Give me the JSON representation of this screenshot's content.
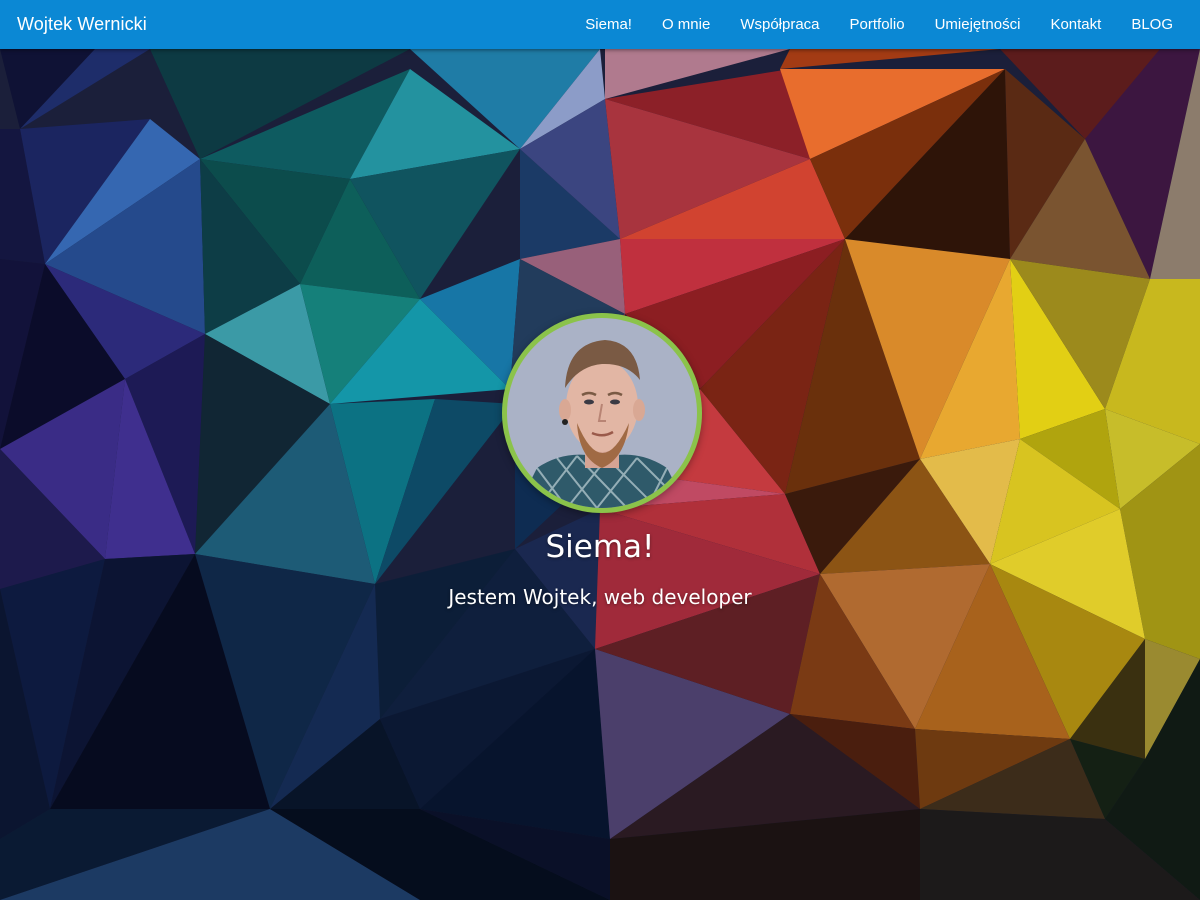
{
  "navbar": {
    "brand": "Wojtek Wernicki",
    "items": [
      {
        "label": "Siema!"
      },
      {
        "label": "O mnie"
      },
      {
        "label": "Współpraca"
      },
      {
        "label": "Portfolio"
      },
      {
        "label": "Umiejętności"
      },
      {
        "label": "Kontakt"
      },
      {
        "label": "BLOG"
      }
    ]
  },
  "hero": {
    "title": "Siema!",
    "subtitle": "Jestem Wojtek, web developer",
    "avatar": "profile-photo",
    "background": "low-poly-triangles"
  },
  "colors": {
    "navbar": "#0b88d4",
    "avatar_ring": "#8bc34a",
    "text": "#ffffff"
  }
}
